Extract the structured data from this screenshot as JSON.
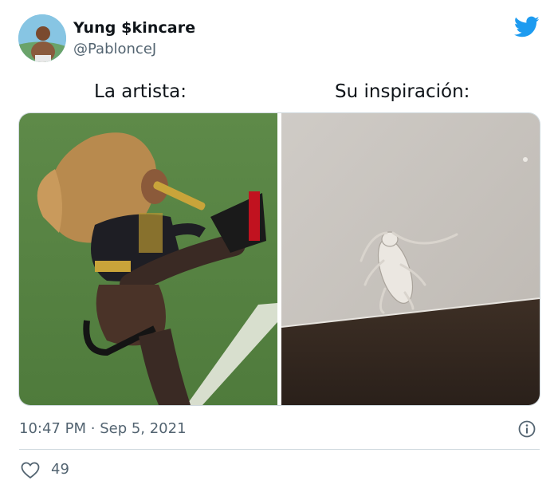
{
  "user": {
    "display_name": "Yung $kincare",
    "handle": "@PablonceJ",
    "avatar_icon": "avatar-photo"
  },
  "brand": {
    "logo_icon": "twitter-bird-icon",
    "color": "#1d9bf0"
  },
  "captions": {
    "left": "La artista:",
    "right": "Su inspiración:"
  },
  "media": {
    "left_photo": "performer-high-kick-photo",
    "right_photo": "cockroach-wall-texture-photo"
  },
  "meta": {
    "time": "10:47 PM",
    "separator": "·",
    "date": "Sep 5, 2021"
  },
  "stats": {
    "likes": "49",
    "like_icon": "heart-icon",
    "info_icon": "info-icon"
  }
}
